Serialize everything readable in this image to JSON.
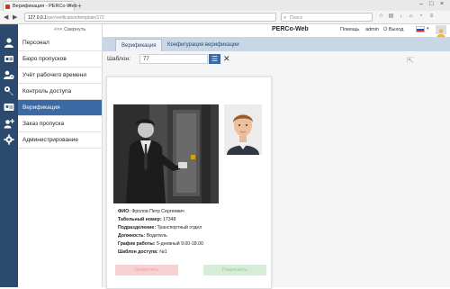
{
  "browser": {
    "tab_title": "Верификация - PERCo-Web",
    "url_host": "127.0.0.1",
    "url_path": "/ver/verification/template/172",
    "search_placeholder": "Поиск"
  },
  "sidebar": {
    "collapse_label": "<<< Свернуть",
    "items": [
      {
        "label": "Персонал",
        "icon": "user-icon"
      },
      {
        "label": "Бюро пропусков",
        "icon": "badge-icon"
      },
      {
        "label": "Учёт рабочего времени",
        "icon": "clock-icon"
      },
      {
        "label": "Контроль доступа",
        "icon": "key-icon"
      },
      {
        "label": "Верификация",
        "icon": "verification-icon",
        "active": true
      },
      {
        "label": "Заказ пропуска",
        "icon": "add-user-icon"
      },
      {
        "label": "Администрирование",
        "icon": "gear-icon"
      }
    ]
  },
  "header": {
    "brand": "PERCo-Web",
    "help": "Помощь",
    "user": "admin",
    "logout": "Выход"
  },
  "tabs": [
    {
      "label": "Верификация",
      "active": true
    },
    {
      "label": "Конфигурация верификации",
      "active": false
    }
  ],
  "toolbar": {
    "template_label": "Шаблон:",
    "template_value": "77"
  },
  "person": {
    "name_label": "ФИО:",
    "name_value": "Фролов Петр Сергеевич",
    "tab_label": "Табельный номер:",
    "tab_value": "17348",
    "dept_label": "Подразделение:",
    "dept_value": "Транспортный отдел",
    "position_label": "Должность:",
    "position_value": "Водитель",
    "schedule_label": "График работы:",
    "schedule_value": "5-дневный 9.00-18.00",
    "access_label": "Шаблон доступа:",
    "access_value": "№1"
  },
  "actions": {
    "reject": "Запретить",
    "accept": "Разрешить"
  },
  "colors": {
    "accent": "#3a69a3",
    "strip": "#2b4a6d",
    "tabs_bg": "#c8d6e6"
  }
}
